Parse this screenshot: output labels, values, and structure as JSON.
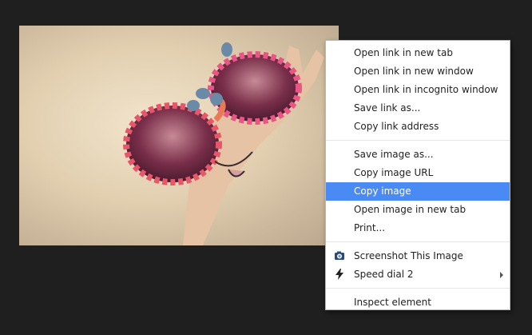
{
  "context_menu": {
    "link_items": [
      "Open link in new tab",
      "Open link in new window",
      "Open link in incognito window",
      "Save link as...",
      "Copy link address"
    ],
    "image_items": [
      "Save image as...",
      "Copy image URL",
      "Copy image",
      "Open image in new tab",
      "Print..."
    ],
    "highlighted_item": "Copy image",
    "extension_items": [
      {
        "label": "Screenshot This Image",
        "icon": "camera-icon"
      },
      {
        "label": "Speed dial 2",
        "icon": "lightning-icon",
        "has_submenu": true
      }
    ],
    "inspect_label": "Inspect element"
  },
  "colors": {
    "page_background": "#1f1f1f",
    "highlight": "#4a8af4"
  }
}
